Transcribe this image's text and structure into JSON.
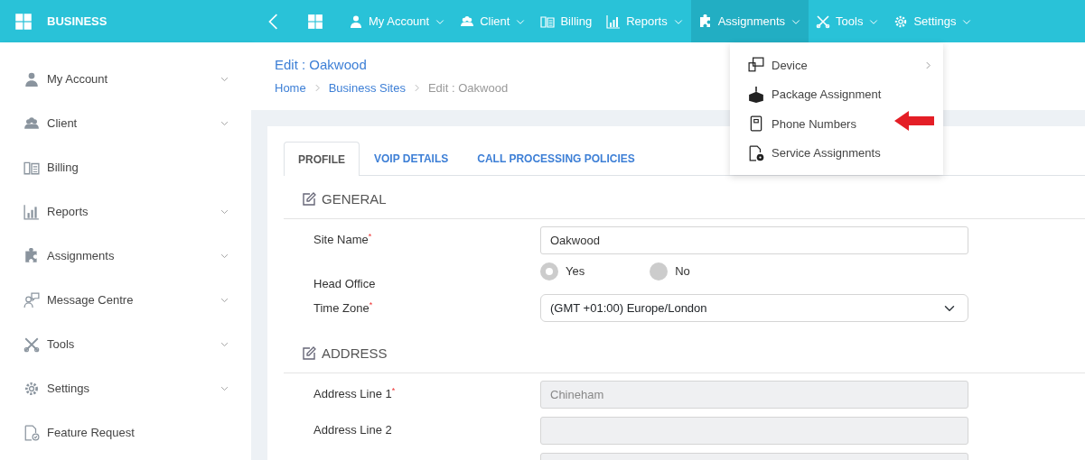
{
  "brand": {
    "title": "BUSINESS"
  },
  "topnav": [
    {
      "label": "My Account",
      "has_menu": true,
      "selected": false
    },
    {
      "label": "Client",
      "has_menu": true,
      "selected": false
    },
    {
      "label": "Billing",
      "has_menu": false,
      "selected": false
    },
    {
      "label": "Reports",
      "has_menu": true,
      "selected": false
    },
    {
      "label": "Assignments",
      "has_menu": true,
      "selected": true
    },
    {
      "label": "Tools",
      "has_menu": true,
      "selected": false
    },
    {
      "label": "Settings",
      "has_menu": true,
      "selected": false
    }
  ],
  "dropdown": [
    {
      "label": "Device",
      "has_submenu": true
    },
    {
      "label": "Package Assignment",
      "has_submenu": false
    },
    {
      "label": "Phone Numbers",
      "has_submenu": false
    },
    {
      "label": "Service Assignments",
      "has_submenu": false
    }
  ],
  "sidebar": {
    "items": [
      {
        "label": "My Account",
        "expandable": true
      },
      {
        "label": "Client",
        "expandable": true
      },
      {
        "label": "Billing",
        "expandable": false
      },
      {
        "label": "Reports",
        "expandable": true
      },
      {
        "label": "Assignments",
        "expandable": true
      },
      {
        "label": "Message Centre",
        "expandable": true
      },
      {
        "label": "Tools",
        "expandable": true
      },
      {
        "label": "Settings",
        "expandable": true
      },
      {
        "label": "Feature Request",
        "expandable": false
      }
    ]
  },
  "page": {
    "title": "Edit : Oakwood",
    "breadcrumb": [
      {
        "label": "Home",
        "current": false
      },
      {
        "label": "Business Sites",
        "current": false
      },
      {
        "label": "Edit : Oakwood",
        "current": true
      }
    ]
  },
  "tabs": [
    {
      "label": "PROFILE",
      "selected": true
    },
    {
      "label": "VOIP DETAILS",
      "selected": false
    },
    {
      "label": "CALL PROCESSING POLICIES",
      "selected": false
    }
  ],
  "sections": [
    {
      "title": "GENERAL",
      "fields": [
        {
          "kind": "input",
          "label": "Site Name",
          "required_mark": "*",
          "value": "Oakwood",
          "disabled": false
        },
        {
          "kind": "radio",
          "label": "Head Office",
          "options": [
            {
              "label": "Yes",
              "selected": true
            },
            {
              "label": "No",
              "selected": false
            }
          ]
        },
        {
          "kind": "select",
          "label": "Time Zone",
          "required_mark": "*",
          "value": "(GMT +01:00) Europe/London"
        }
      ]
    },
    {
      "title": "ADDRESS",
      "fields": [
        {
          "kind": "input",
          "label": "Address Line 1",
          "required_mark": "*",
          "value": "Chineham",
          "disabled": true
        },
        {
          "kind": "input",
          "label": "Address Line 2",
          "disabled": true
        },
        {
          "kind": "input",
          "disabled": true
        }
      ]
    }
  ]
}
